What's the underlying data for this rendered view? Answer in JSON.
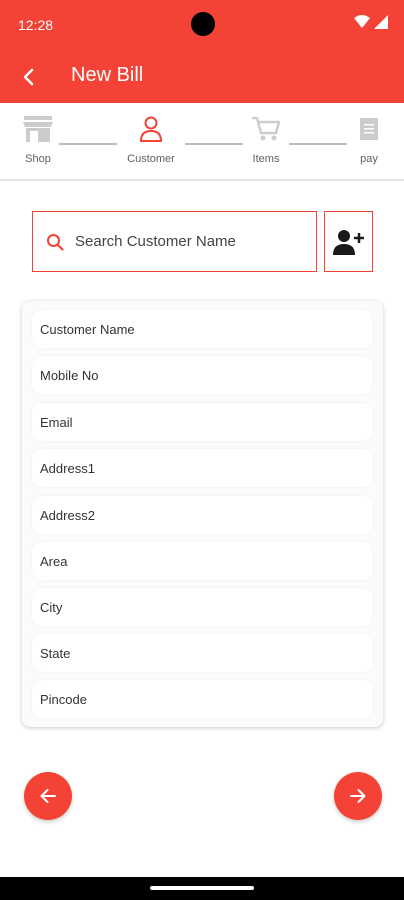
{
  "status_bar": {
    "time": "12:28"
  },
  "app_bar": {
    "title": "New Bill"
  },
  "stepper": {
    "steps": [
      {
        "label": "Shop",
        "icon": "store-icon",
        "active": false
      },
      {
        "label": "Customer",
        "icon": "person-icon",
        "active": true
      },
      {
        "label": "Items",
        "icon": "cart-icon",
        "active": false
      },
      {
        "label": "pay",
        "icon": "receipt-icon",
        "active": false
      }
    ]
  },
  "search": {
    "placeholder": "Search Customer Name"
  },
  "form": {
    "fields": [
      {
        "placeholder": "Customer Name"
      },
      {
        "placeholder": "Mobile No"
      },
      {
        "placeholder": "Email"
      },
      {
        "placeholder": "Address1"
      },
      {
        "placeholder": "Address2"
      },
      {
        "placeholder": "Area"
      },
      {
        "placeholder": "City"
      },
      {
        "placeholder": "State"
      },
      {
        "placeholder": "Pincode"
      }
    ]
  },
  "colors": {
    "primary": "#f44336",
    "inactive_icon": "#cccccc",
    "background": "#ffffff"
  }
}
